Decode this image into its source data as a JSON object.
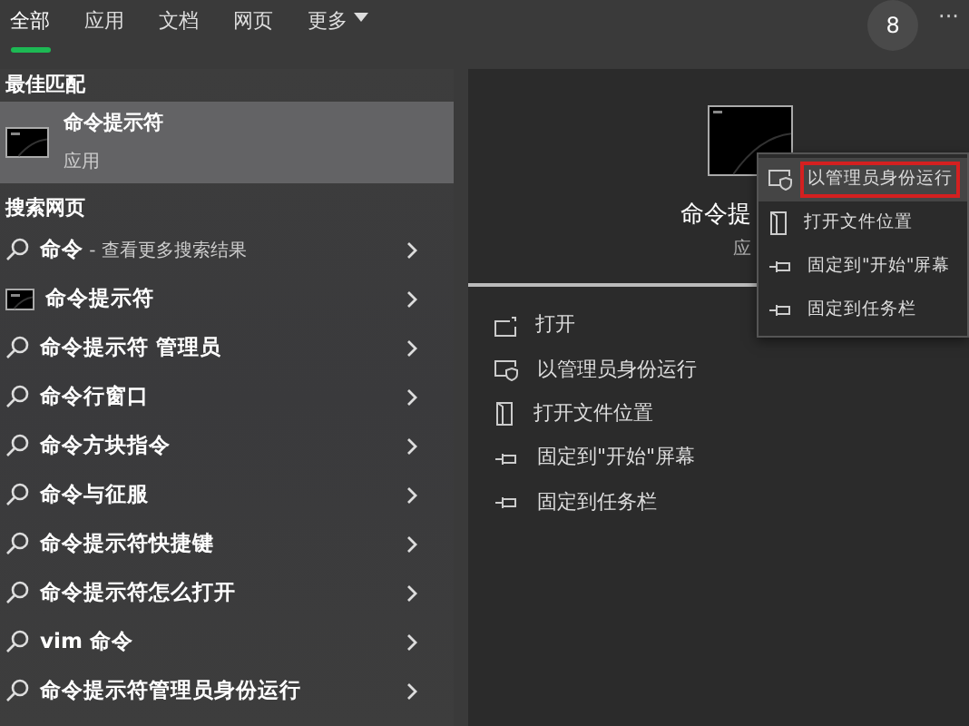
{
  "tabs": [
    {
      "label": "全部",
      "selected": true
    },
    {
      "label": "应用",
      "selected": false
    },
    {
      "label": "文档",
      "selected": false
    },
    {
      "label": "网页",
      "selected": false
    },
    {
      "label": "更多",
      "selected": false,
      "dropdown": true
    }
  ],
  "badge": "8",
  "more_button": "···",
  "best_match": {
    "heading": "最佳匹配",
    "title": "命令提示符",
    "subtitle": "应用",
    "selected": true
  },
  "web_search": {
    "heading": "搜索网页",
    "items": [
      {
        "kind": "search",
        "text": "命令",
        "hint": " - 查看更多搜索结果"
      },
      {
        "kind": "app",
        "text": "命令提示符"
      },
      {
        "kind": "search",
        "text": "命令提示符 管理员"
      },
      {
        "kind": "search",
        "text": "命令行窗口"
      },
      {
        "kind": "search",
        "text": "命令方块指令"
      },
      {
        "kind": "search",
        "text": "命令与征服"
      },
      {
        "kind": "search",
        "text": "命令提示符快捷键"
      },
      {
        "kind": "search",
        "text": "命令提示符怎么打开"
      },
      {
        "kind": "search",
        "text": "vim 命令"
      },
      {
        "kind": "search",
        "text": "命令提示符管理员身份运行"
      }
    ]
  },
  "preview": {
    "title": "命令提",
    "subtitle": "应",
    "actions": [
      {
        "kind": "open",
        "label": "打开"
      },
      {
        "kind": "admin",
        "label": "以管理员身份运行"
      },
      {
        "kind": "folder",
        "label": "打开文件位置"
      },
      {
        "kind": "pin",
        "label": "固定到\"开始\"屏幕"
      },
      {
        "kind": "pin",
        "label": "固定到任务栏"
      }
    ]
  },
  "context_menu": {
    "items": [
      {
        "kind": "admin",
        "label": "以管理员身份运行",
        "selected": true,
        "highlighted": true
      },
      {
        "kind": "folder",
        "label": "打开文件位置",
        "selected": false,
        "highlighted": false
      },
      {
        "kind": "pin",
        "label": "固定到\"开始\"屏幕",
        "selected": false,
        "highlighted": false
      },
      {
        "kind": "pin",
        "label": "固定到任务栏",
        "selected": false,
        "highlighted": false
      }
    ]
  }
}
